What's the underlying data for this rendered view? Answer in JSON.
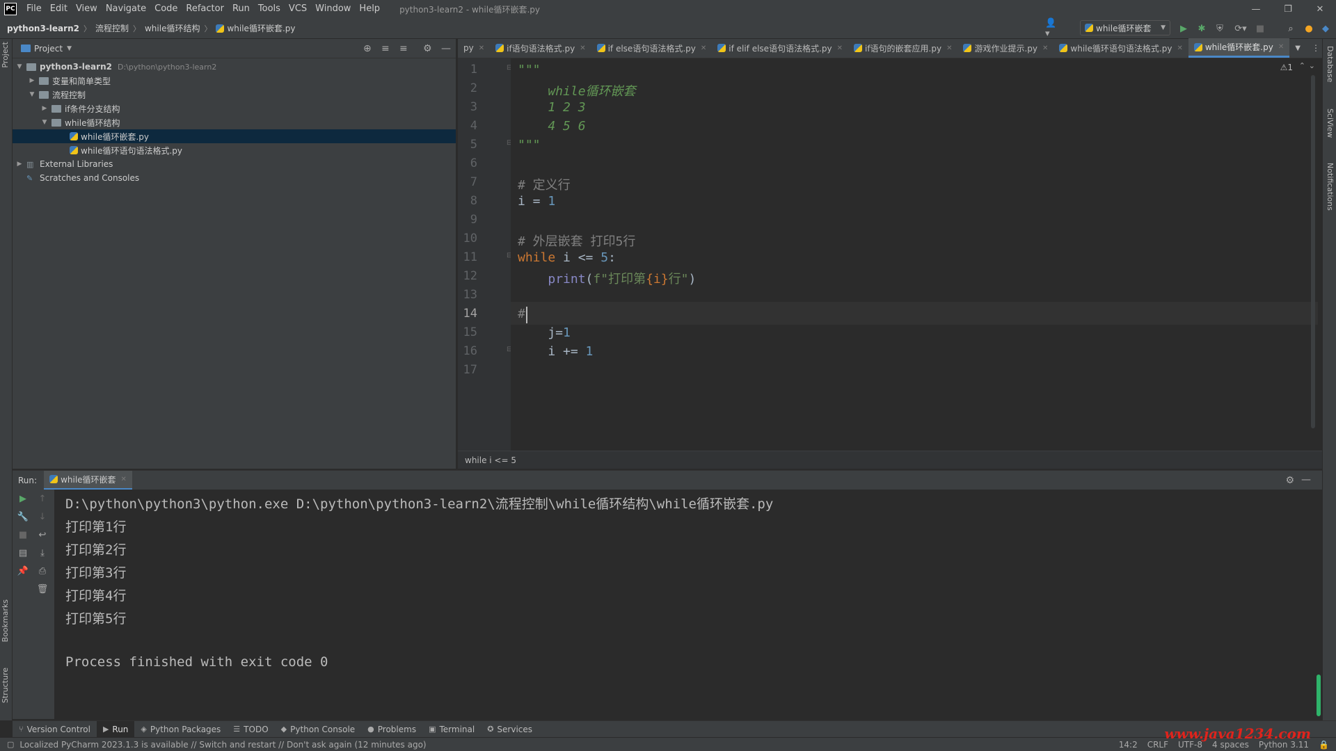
{
  "titlebar": {
    "logo": "PC",
    "menus": [
      "File",
      "Edit",
      "View",
      "Navigate",
      "Code",
      "Refactor",
      "Run",
      "Tools",
      "VCS",
      "Window",
      "Help"
    ],
    "window_title": "python3-learn2 - while循环嵌套.py",
    "controls": {
      "minimize": "—",
      "restore": "❐",
      "close": "✕"
    }
  },
  "navbar": {
    "crumbs": [
      "python3-learn2",
      "流程控制",
      "while循环结构",
      "while循环嵌套.py"
    ],
    "run_config": "while循环嵌套"
  },
  "project": {
    "header": "Project",
    "tree": [
      {
        "label": "python3-learn2",
        "path": "D:\\python\\python3-learn2",
        "level": 0,
        "expanded": true,
        "type": "folder"
      },
      {
        "label": "变量和简单类型",
        "level": 1,
        "expanded": false,
        "type": "folder"
      },
      {
        "label": "流程控制",
        "level": 1,
        "expanded": true,
        "type": "folder"
      },
      {
        "label": "if条件分支结构",
        "level": 2,
        "expanded": false,
        "type": "folder"
      },
      {
        "label": "while循环结构",
        "level": 2,
        "expanded": true,
        "type": "folder"
      },
      {
        "label": "while循环嵌套.py",
        "level": 3,
        "type": "file",
        "selected": true
      },
      {
        "label": "while循环语句语法格式.py",
        "level": 3,
        "type": "file"
      },
      {
        "label": "External Libraries",
        "level": 0,
        "expanded": false,
        "type": "lib"
      },
      {
        "label": "Scratches and Consoles",
        "level": 0,
        "type": "scratch"
      }
    ]
  },
  "editor": {
    "tabs": [
      {
        "label": "py",
        "active": false
      },
      {
        "label": "if语句语法格式.py",
        "active": false
      },
      {
        "label": "if else语句语法格式.py",
        "active": false
      },
      {
        "label": "if elif else语句语法格式.py",
        "active": false
      },
      {
        "label": "if语句的嵌套应用.py",
        "active": false
      },
      {
        "label": "游戏作业提示.py",
        "active": false
      },
      {
        "label": "while循环语句语法格式.py",
        "active": false
      },
      {
        "label": "while循环嵌套.py",
        "active": true
      }
    ],
    "warning_count": "⚠1",
    "current_line": 14,
    "lines": [
      "\"\"\"",
      "    while循环嵌套",
      "    1 2 3",
      "    4 5 6",
      "\"\"\"",
      "",
      "# 定义行",
      "i = 1",
      "",
      "# 外层嵌套 打印5行",
      "while i <= 5:",
      "    print(f\"打印第{i}行\")",
      "",
      "#",
      "    j=1",
      "    i += 1",
      ""
    ],
    "breadcrumb": "while i <= 5"
  },
  "run": {
    "label": "Run:",
    "tab": "while循环嵌套",
    "output": [
      "D:\\python\\python3\\python.exe D:\\python\\python3-learn2\\流程控制\\while循环结构\\while循环嵌套.py",
      "打印第1行",
      "打印第2行",
      "打印第3行",
      "打印第4行",
      "打印第5行",
      "",
      "Process finished with exit code 0"
    ]
  },
  "side_labels": {
    "left_top": "Project",
    "left_bookmarks": "Bookmarks",
    "left_structure": "Structure",
    "right": [
      "Database",
      "SciView",
      "Notifications"
    ]
  },
  "bottom_tools": [
    {
      "label": "Version Control",
      "icon": "branch-icon"
    },
    {
      "label": "Run",
      "icon": "play-icon",
      "active": true
    },
    {
      "label": "Python Packages",
      "icon": "packages-icon"
    },
    {
      "label": "TODO",
      "icon": "list-icon"
    },
    {
      "label": "Python Console",
      "icon": "python-icon"
    },
    {
      "label": "Problems",
      "icon": "info-icon"
    },
    {
      "label": "Terminal",
      "icon": "terminal-icon"
    },
    {
      "label": "Services",
      "icon": "services-icon"
    }
  ],
  "statusbar": {
    "message": "Localized PyCharm 2023.1.3 is available // Switch and restart // Don't ask again (12 minutes ago)",
    "position": "14:2",
    "line_sep": "CRLF",
    "encoding": "UTF-8",
    "indent": "4 spaces",
    "interpreter": "Python 3.11",
    "watermark": "www.java1234.com"
  },
  "colors": {
    "accent": "#4a88c7",
    "selection": "#0d293e",
    "keyword": "#cc7832",
    "number": "#6897bb",
    "docstring": "#629755",
    "comment": "#808080",
    "watermark": "#e0231c"
  }
}
